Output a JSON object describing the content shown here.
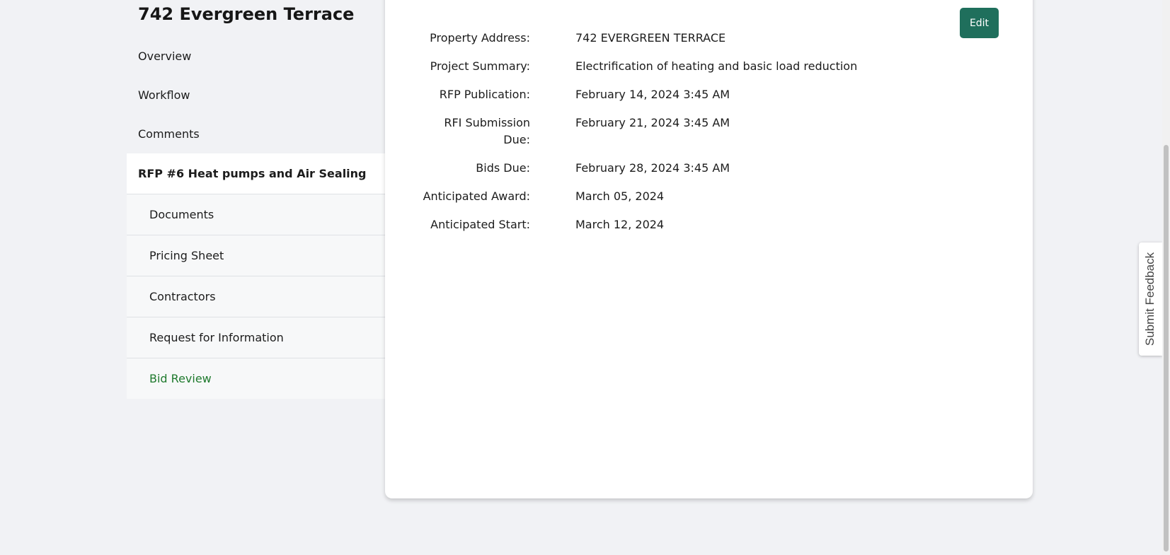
{
  "header": {
    "title": "742 Evergreen Terrace"
  },
  "sidebar": {
    "items": [
      {
        "label": "Overview"
      },
      {
        "label": "Workflow"
      },
      {
        "label": "Comments"
      }
    ],
    "rfp": {
      "label": "RFP #6 Heat pumps and Air Sealing",
      "sub_items": [
        {
          "label": "Documents"
        },
        {
          "label": "Pricing Sheet"
        },
        {
          "label": "Contractors"
        },
        {
          "label": "Request for Information"
        },
        {
          "label": "Bid Review"
        }
      ]
    }
  },
  "main": {
    "edit_label": "Edit",
    "details": [
      {
        "label": "Property Address:",
        "value": "742 EVERGREEN TERRACE"
      },
      {
        "label": "Project Summary:",
        "value": "Electrification of heating and basic load reduction"
      },
      {
        "label": "RFP Publication:",
        "value": "February 14, 2024 3:45 AM"
      },
      {
        "label": "RFI Submission Due:",
        "value": "February 21, 2024 3:45 AM"
      },
      {
        "label": "Bids Due:",
        "value": "February 28, 2024 3:45 AM"
      },
      {
        "label": "Anticipated Award:",
        "value": "March 05, 2024"
      },
      {
        "label": "Anticipated Start:",
        "value": "March 12, 2024"
      }
    ]
  },
  "feedback": {
    "label": "Submit Feedback"
  },
  "colors": {
    "accent": "#1f6f5c",
    "active_link": "#1f7a2e",
    "background": "#f1f2f5"
  }
}
